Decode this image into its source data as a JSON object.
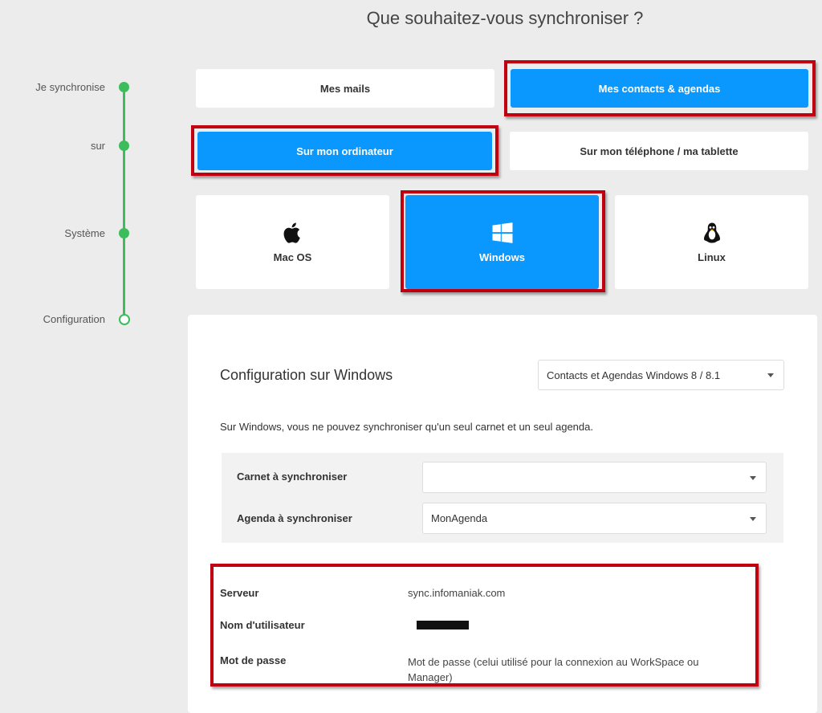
{
  "page": {
    "title": "Que souhaitez-vous synchroniser ?"
  },
  "stepper": {
    "steps": [
      {
        "label": "Je synchronise"
      },
      {
        "label": "sur"
      },
      {
        "label": "Système"
      },
      {
        "label": "Configuration"
      }
    ]
  },
  "what": {
    "mails_label": "Mes mails",
    "contacts_label": "Mes contacts & agendas",
    "selected": "contacts"
  },
  "where": {
    "computer_label": "Sur mon ordinateur",
    "phone_label": "Sur mon téléphone / ma tablette",
    "selected": "computer"
  },
  "os": {
    "options": [
      {
        "label": "Mac OS",
        "icon": "apple-icon"
      },
      {
        "label": "Windows",
        "icon": "windows-icon"
      },
      {
        "label": "Linux",
        "icon": "linux-icon"
      }
    ],
    "selected": "Windows"
  },
  "config": {
    "title": "Configuration sur Windows",
    "version_select": "Contacts et Agendas Windows 8 / 8.1",
    "note": "Sur Windows, vous ne pouvez synchroniser qu'un seul carnet et un seul agenda.",
    "carnet_label": "Carnet à synchroniser",
    "carnet_value": "",
    "agenda_label": "Agenda à synchroniser",
    "agenda_value": "MonAgenda",
    "server_label": "Serveur",
    "server_value": "sync.infomaniak.com",
    "username_label": "Nom d'utilisateur",
    "password_label": "Mot de passe",
    "password_value_line1": "Mot de passe (celui utilisé pour la connexion au WorkSpace ou",
    "password_value_line2": "Manager)"
  },
  "colors": {
    "accent": "#0a98ff",
    "stepper": "#3cbc5a",
    "highlight": "#c00010"
  }
}
